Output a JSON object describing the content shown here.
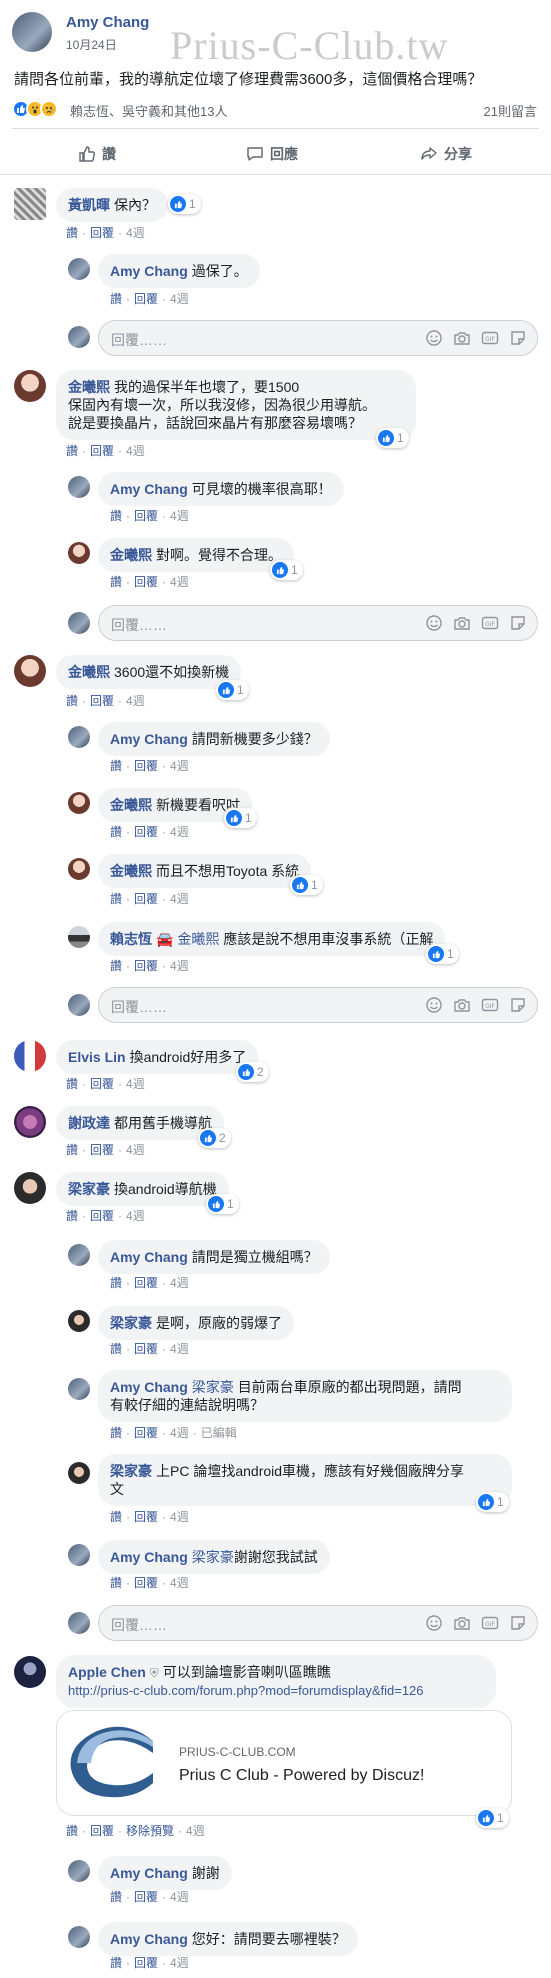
{
  "post": {
    "author": "Amy Chang",
    "date": "10月24日",
    "watermark": "Prius-C-Club.tw",
    "body": "請問各位前輩，我的導航定位壞了修理費需3600多，這個價格合理嗎？",
    "reactions_text": "賴志恆、吳守義和其他13人",
    "comments_count": "21則留言"
  },
  "actions": {
    "like": "讚",
    "comment": "回應",
    "share": "分享"
  },
  "meta": {
    "like": "讚",
    "reply": "回覆",
    "time": "4週",
    "edited": "已編輯",
    "remove_preview": "移除預覽"
  },
  "reply_placeholder": "回覆……",
  "comments": [
    {
      "name": "黃凱暉",
      "text": "保內？",
      "likes": "1"
    },
    {
      "name": "Amy Chang",
      "text": "過保了。"
    },
    {
      "name": "金曦熙",
      "text1": "我的過保半年也壞了，要1500",
      "text2": "保固內有壞一次，所以我沒修，因為很少用導航。",
      "text3": "說是要換晶片，話說回來晶片有那麼容易壞嗎？",
      "likes": "1"
    },
    {
      "name": "Amy Chang",
      "text": "可見壞的機率很高耶！"
    },
    {
      "name": "金曦熙",
      "text": "對啊。覺得不合理。",
      "likes": "1"
    },
    {
      "name": "金曦熙",
      "text": "3600還不如換新機",
      "likes": "1"
    },
    {
      "name": "Amy Chang",
      "text": "請問新機要多少錢？"
    },
    {
      "name": "金曦熙",
      "text": "新機要看呎吋",
      "likes": "1"
    },
    {
      "name": "金曦熙",
      "text": "而且不想用Toyota 系統",
      "likes": "1"
    },
    {
      "name": "賴志恆",
      "mention": "金曦熙",
      "text": "應該是說不想用車沒事系統（正解",
      "likes": "1"
    },
    {
      "name": "Elvis Lin",
      "text": "換android好用多了",
      "likes": "2"
    },
    {
      "name": "謝政達",
      "text": "都用舊手機導航",
      "likes": "2"
    },
    {
      "name": "梁家豪",
      "text": "換android導航機",
      "likes": "1"
    },
    {
      "name": "Amy Chang",
      "text": "請問是獨立機組嗎？"
    },
    {
      "name": "梁家豪",
      "text": "是啊，原廠的弱爆了"
    },
    {
      "name": "Amy Chang",
      "mention": "梁家豪",
      "text1": "目前兩台車原廠的都出現問題，請問",
      "text2": "有較仔細的連結說明嗎？"
    },
    {
      "name": "梁家豪",
      "text1": "上PC 論壇找android車機，應該有好幾個廠牌分享",
      "text2": "文",
      "likes": "1"
    },
    {
      "name": "Amy Chang",
      "mention": "梁家豪",
      "text": "謝謝您我試試"
    },
    {
      "name": "Apple Chen",
      "text": "可以到論壇影音喇叭區瞧瞧",
      "link": "http://prius-c-club.com/forum.php?mod=forumdisplay&fid=126",
      "preview_domain": "PRIUS-C-CLUB.COM",
      "preview_title": "Prius C Club - Powered by Discuz!",
      "likes": "1"
    },
    {
      "name": "Amy Chang",
      "text": "謝謝"
    },
    {
      "name": "Amy Chang",
      "text": "您好：請問要去哪裡裝？"
    }
  ],
  "colors": {
    "link": "#385898",
    "like_blue": "#1877f2",
    "bubble": "#f2f3f5",
    "meta": "#90949c"
  }
}
